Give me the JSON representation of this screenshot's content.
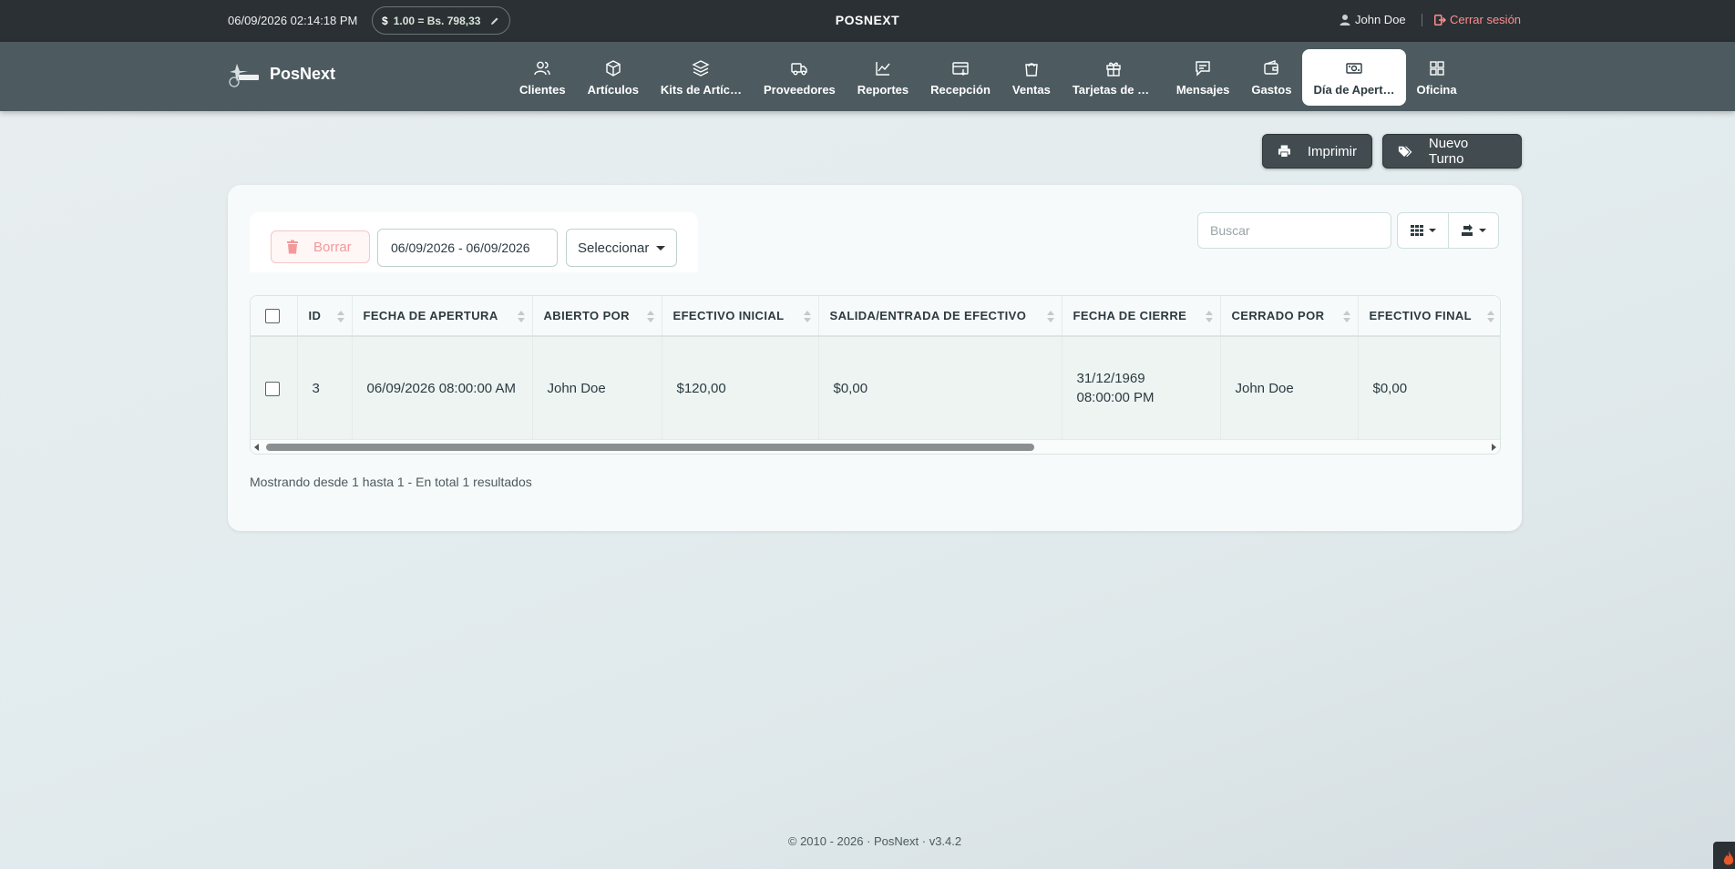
{
  "topbar": {
    "datetime": "06/09/2026 02:14:18 PM",
    "rate_currency": "$",
    "rate_text": "1.00 = Bs. 798,33",
    "brand": "POSNEXT",
    "user_name": "John Doe",
    "logout_label": "Cerrar sesión"
  },
  "navbar": {
    "app_name": "PosNext",
    "items": [
      {
        "label": "Clientes",
        "icon": "users-icon"
      },
      {
        "label": "Artículos",
        "icon": "box-icon"
      },
      {
        "label": "Kits de Artíc…",
        "icon": "layers-icon"
      },
      {
        "label": "Proveedores",
        "icon": "truck-icon"
      },
      {
        "label": "Reportes",
        "icon": "chart-line-icon"
      },
      {
        "label": "Recepción",
        "icon": "inbox-download-icon"
      },
      {
        "label": "Ventas",
        "icon": "shopping-bag-icon"
      },
      {
        "label": "Tarjetas de R…",
        "icon": "gift-icon"
      },
      {
        "label": "Mensajes",
        "icon": "message-icon"
      },
      {
        "label": "Gastos",
        "icon": "wallet-icon"
      },
      {
        "label": "Día de Apert…",
        "icon": "cash-register-icon",
        "active": true
      },
      {
        "label": "Oficina",
        "icon": "grid-icon"
      }
    ]
  },
  "actions": {
    "print_label": "Imprimir",
    "new_shift_label": "Nuevo Turno"
  },
  "filters": {
    "delete_label": "Borrar",
    "date_range": "06/09/2026 - 06/09/2026",
    "select_label": "Seleccionar",
    "search_placeholder": "Buscar"
  },
  "table": {
    "columns": [
      "ID",
      "FECHA DE APERTURA",
      "ABIERTO POR",
      "EFECTIVO INICIAL",
      "SALIDA/ENTRADA DE EFECTIVO",
      "FECHA DE CIERRE",
      "CERRADO POR",
      "EFECTIVO FINAL"
    ],
    "rows": [
      [
        "3",
        "06/09/2026 08:00:00 AM",
        "John Doe",
        "$120,00",
        "$0,00",
        "31/12/1969 08:00:00 PM",
        "John Doe",
        "$0,00"
      ]
    ],
    "summary": "Mostrando desde 1 hasta 1 - En total 1 resultados"
  },
  "footer": {
    "text": "© 2010 - 2026 · PosNext · v3.4.2"
  },
  "colors": {
    "topbar_bg": "#2b3034",
    "navbar_bg": "#4d5b61",
    "logout": "#ff8e8e",
    "delete": "#f29a9a",
    "button_dark": "#414b50"
  }
}
